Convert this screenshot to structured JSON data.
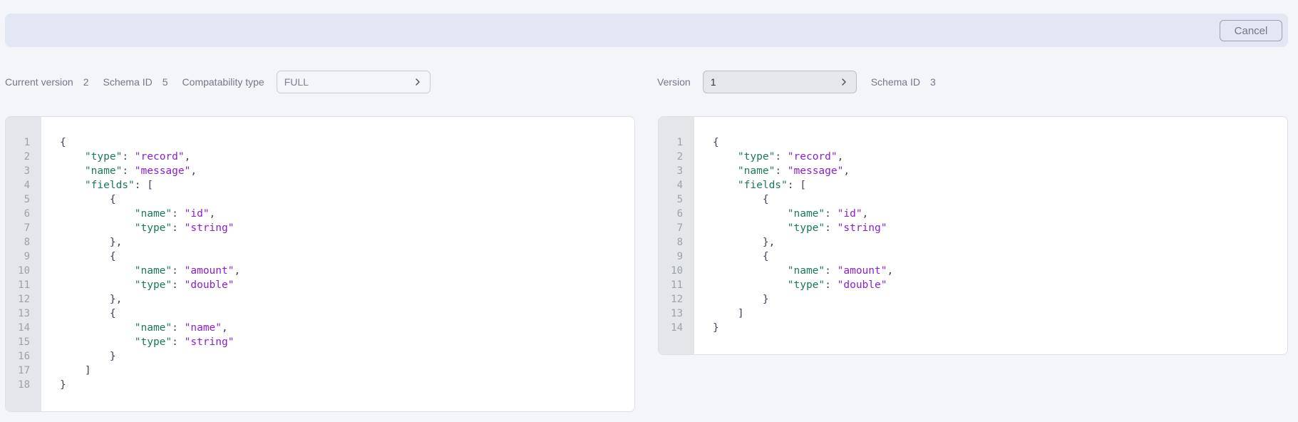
{
  "toolbar": {
    "cancel_label": "Cancel"
  },
  "left_meta": {
    "current_version_label": "Current version",
    "current_version_value": "2",
    "schema_id_label": "Schema ID",
    "schema_id_value": "5",
    "compat_label": "Compatability type",
    "compat_value": "FULL",
    "compat_icon": "chevron-right-icon"
  },
  "right_meta": {
    "version_label": "Version",
    "version_value": "1",
    "version_icon": "chevron-right-icon",
    "schema_id_label": "Schema ID",
    "schema_id_value": "3"
  },
  "colors": {
    "key": "#1a7a55",
    "string": "#8b1fd1",
    "punct": "#3d4454",
    "gutter": "#e4e6eb",
    "toolbar": "#e3e6f3"
  },
  "left_editor": {
    "lines": [
      {
        "n": "1",
        "indent": 0,
        "tokens": [
          [
            "p",
            "{"
          ]
        ]
      },
      {
        "n": "2",
        "indent": 1,
        "tokens": [
          [
            "k",
            "\"type\""
          ],
          [
            "p",
            ": "
          ],
          [
            "s",
            "\"record\""
          ],
          [
            "p",
            ","
          ]
        ]
      },
      {
        "n": "3",
        "indent": 1,
        "tokens": [
          [
            "k",
            "\"name\""
          ],
          [
            "p",
            ": "
          ],
          [
            "s",
            "\"message\""
          ],
          [
            "p",
            ","
          ]
        ]
      },
      {
        "n": "4",
        "indent": 1,
        "tokens": [
          [
            "k",
            "\"fields\""
          ],
          [
            "p",
            ": ["
          ]
        ]
      },
      {
        "n": "5",
        "indent": 2,
        "tokens": [
          [
            "p",
            "{"
          ]
        ]
      },
      {
        "n": "6",
        "indent": 3,
        "tokens": [
          [
            "k",
            "\"name\""
          ],
          [
            "p",
            ": "
          ],
          [
            "s",
            "\"id\""
          ],
          [
            "p",
            ","
          ]
        ]
      },
      {
        "n": "7",
        "indent": 3,
        "tokens": [
          [
            "k",
            "\"type\""
          ],
          [
            "p",
            ": "
          ],
          [
            "s",
            "\"string\""
          ]
        ]
      },
      {
        "n": "8",
        "indent": 2,
        "tokens": [
          [
            "p",
            "},"
          ]
        ]
      },
      {
        "n": "9",
        "indent": 2,
        "tokens": [
          [
            "p",
            "{"
          ]
        ]
      },
      {
        "n": "10",
        "indent": 3,
        "tokens": [
          [
            "k",
            "\"name\""
          ],
          [
            "p",
            ": "
          ],
          [
            "s",
            "\"amount\""
          ],
          [
            "p",
            ","
          ]
        ]
      },
      {
        "n": "11",
        "indent": 3,
        "tokens": [
          [
            "k",
            "\"type\""
          ],
          [
            "p",
            ": "
          ],
          [
            "s",
            "\"double\""
          ]
        ]
      },
      {
        "n": "12",
        "indent": 2,
        "tokens": [
          [
            "p",
            "},"
          ]
        ]
      },
      {
        "n": "13",
        "indent": 2,
        "tokens": [
          [
            "p",
            "{"
          ]
        ]
      },
      {
        "n": "14",
        "indent": 3,
        "tokens": [
          [
            "k",
            "\"name\""
          ],
          [
            "p",
            ": "
          ],
          [
            "s",
            "\"name\""
          ],
          [
            "p",
            ","
          ]
        ]
      },
      {
        "n": "15",
        "indent": 3,
        "tokens": [
          [
            "k",
            "\"type\""
          ],
          [
            "p",
            ": "
          ],
          [
            "s",
            "\"string\""
          ]
        ]
      },
      {
        "n": "16",
        "indent": 2,
        "tokens": [
          [
            "p",
            "}"
          ]
        ]
      },
      {
        "n": "17",
        "indent": 1,
        "tokens": [
          [
            "p",
            "]"
          ]
        ]
      },
      {
        "n": "18",
        "indent": 0,
        "tokens": [
          [
            "p",
            "}"
          ]
        ]
      }
    ]
  },
  "right_editor": {
    "lines": [
      {
        "n": "1",
        "indent": 0,
        "tokens": [
          [
            "p",
            "{"
          ]
        ]
      },
      {
        "n": "2",
        "indent": 1,
        "tokens": [
          [
            "k",
            "\"type\""
          ],
          [
            "p",
            ": "
          ],
          [
            "s",
            "\"record\""
          ],
          [
            "p",
            ","
          ]
        ]
      },
      {
        "n": "3",
        "indent": 1,
        "tokens": [
          [
            "k",
            "\"name\""
          ],
          [
            "p",
            ": "
          ],
          [
            "s",
            "\"message\""
          ],
          [
            "p",
            ","
          ]
        ]
      },
      {
        "n": "4",
        "indent": 1,
        "tokens": [
          [
            "k",
            "\"fields\""
          ],
          [
            "p",
            ": ["
          ]
        ]
      },
      {
        "n": "5",
        "indent": 2,
        "tokens": [
          [
            "p",
            "{"
          ]
        ]
      },
      {
        "n": "6",
        "indent": 3,
        "tokens": [
          [
            "k",
            "\"name\""
          ],
          [
            "p",
            ": "
          ],
          [
            "s",
            "\"id\""
          ],
          [
            "p",
            ","
          ]
        ]
      },
      {
        "n": "7",
        "indent": 3,
        "tokens": [
          [
            "k",
            "\"type\""
          ],
          [
            "p",
            ": "
          ],
          [
            "s",
            "\"string\""
          ]
        ]
      },
      {
        "n": "8",
        "indent": 2,
        "tokens": [
          [
            "p",
            "},"
          ]
        ]
      },
      {
        "n": "9",
        "indent": 2,
        "tokens": [
          [
            "p",
            "{"
          ]
        ]
      },
      {
        "n": "10",
        "indent": 3,
        "tokens": [
          [
            "k",
            "\"name\""
          ],
          [
            "p",
            ": "
          ],
          [
            "s",
            "\"amount\""
          ],
          [
            "p",
            ","
          ]
        ]
      },
      {
        "n": "11",
        "indent": 3,
        "tokens": [
          [
            "k",
            "\"type\""
          ],
          [
            "p",
            ": "
          ],
          [
            "s",
            "\"double\""
          ]
        ]
      },
      {
        "n": "12",
        "indent": 2,
        "tokens": [
          [
            "p",
            "}"
          ]
        ]
      },
      {
        "n": "13",
        "indent": 1,
        "tokens": [
          [
            "p",
            "]"
          ]
        ]
      },
      {
        "n": "14",
        "indent": 0,
        "tokens": [
          [
            "p",
            "}"
          ]
        ]
      }
    ]
  }
}
